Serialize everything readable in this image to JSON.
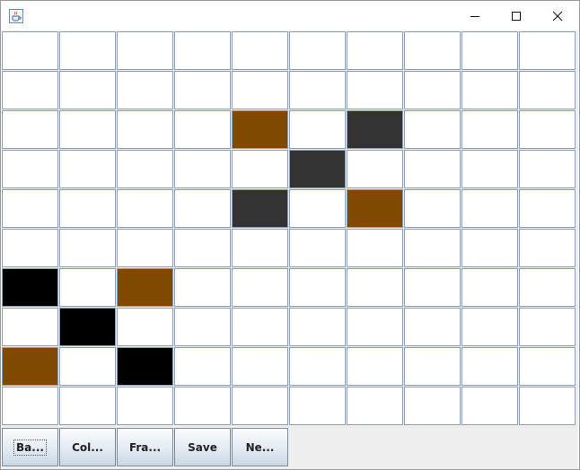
{
  "window": {
    "icon": "java-coffee-icon",
    "controls": {
      "minimize": "minimize-icon",
      "maximize": "maximize-icon",
      "close": "close-icon"
    }
  },
  "grid": {
    "rows": 10,
    "cols": 10,
    "default_color": "#ffffff",
    "colors": {
      "brown": "#7f4a00",
      "dark": "#333333",
      "black": "#000000"
    },
    "filled_cells": [
      {
        "row": 2,
        "col": 4,
        "color": "brown"
      },
      {
        "row": 2,
        "col": 6,
        "color": "dark"
      },
      {
        "row": 3,
        "col": 5,
        "color": "dark"
      },
      {
        "row": 4,
        "col": 4,
        "color": "dark"
      },
      {
        "row": 4,
        "col": 6,
        "color": "brown"
      },
      {
        "row": 6,
        "col": 0,
        "color": "black"
      },
      {
        "row": 6,
        "col": 2,
        "color": "brown"
      },
      {
        "row": 7,
        "col": 1,
        "color": "black"
      },
      {
        "row": 8,
        "col": 0,
        "color": "brown"
      },
      {
        "row": 8,
        "col": 2,
        "color": "black"
      }
    ]
  },
  "toolbar": {
    "buttons": [
      {
        "label": "Ba...",
        "name": "ba-button",
        "focused": true
      },
      {
        "label": "Col...",
        "name": "col-button",
        "focused": false
      },
      {
        "label": "Fra...",
        "name": "fra-button",
        "focused": false
      },
      {
        "label": "Save",
        "name": "save-button",
        "focused": false
      },
      {
        "label": "Ne...",
        "name": "ne-button",
        "focused": false
      }
    ]
  }
}
